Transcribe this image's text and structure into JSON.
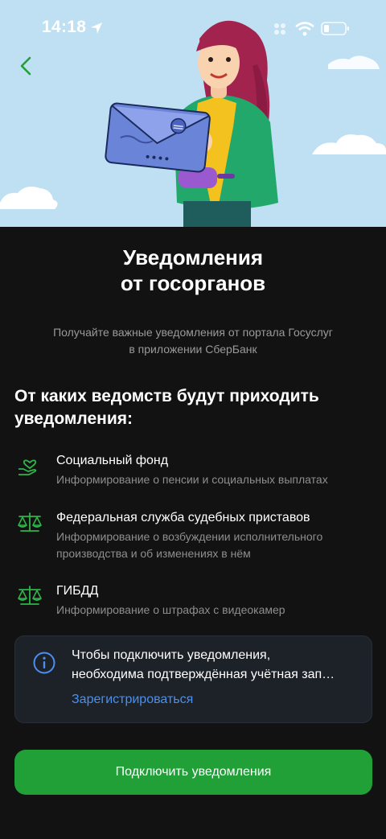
{
  "status_bar": {
    "time": "14:18",
    "icons": [
      "location-arrow-icon",
      "cellular-icon",
      "wifi-icon",
      "battery-icon"
    ]
  },
  "header": {
    "back_icon": "chevron-left-icon",
    "illustration": "woman-with-envelope-illustration"
  },
  "page": {
    "title_line1": "Уведомления",
    "title_line2": "от госорганов",
    "subtitle_line1": "Получайте важные уведомления от портала Госуслуг",
    "subtitle_line2": "в приложении СберБанк"
  },
  "section": {
    "title_line1": "От каких ведомств будут приходить",
    "title_line2": "уведомления:"
  },
  "agencies": [
    {
      "icon": "heart-hand-icon",
      "name": "Социальный фонд",
      "desc_line1": "Информирование о пенсии и социальных выплатах",
      "desc_line2": ""
    },
    {
      "icon": "scales-icon",
      "name": "Федеральная служба судебных приставов",
      "desc_line1": "Информирование о возбуждении исполнительного",
      "desc_line2": "производства и об изменениях в нём"
    },
    {
      "icon": "scales-icon",
      "name": "ГИБДД",
      "desc_line1": "Информирование о штрафах с видеокамер",
      "desc_line2": ""
    }
  ],
  "info_card": {
    "icon": "info-icon",
    "text_line1": "Чтобы подключить уведомления,",
    "text_line2": "необходима подтверждённая учётная зап…",
    "link_label": "Зарегистрироваться"
  },
  "primary_button": {
    "label": "Подключить уведомления"
  },
  "colors": {
    "accent_green": "#21a038",
    "icon_green": "#2fb54a",
    "link_blue": "#4a90f0",
    "background": "#121212",
    "card_background": "#1d2128",
    "hero_sky": "#bfe0f3"
  }
}
